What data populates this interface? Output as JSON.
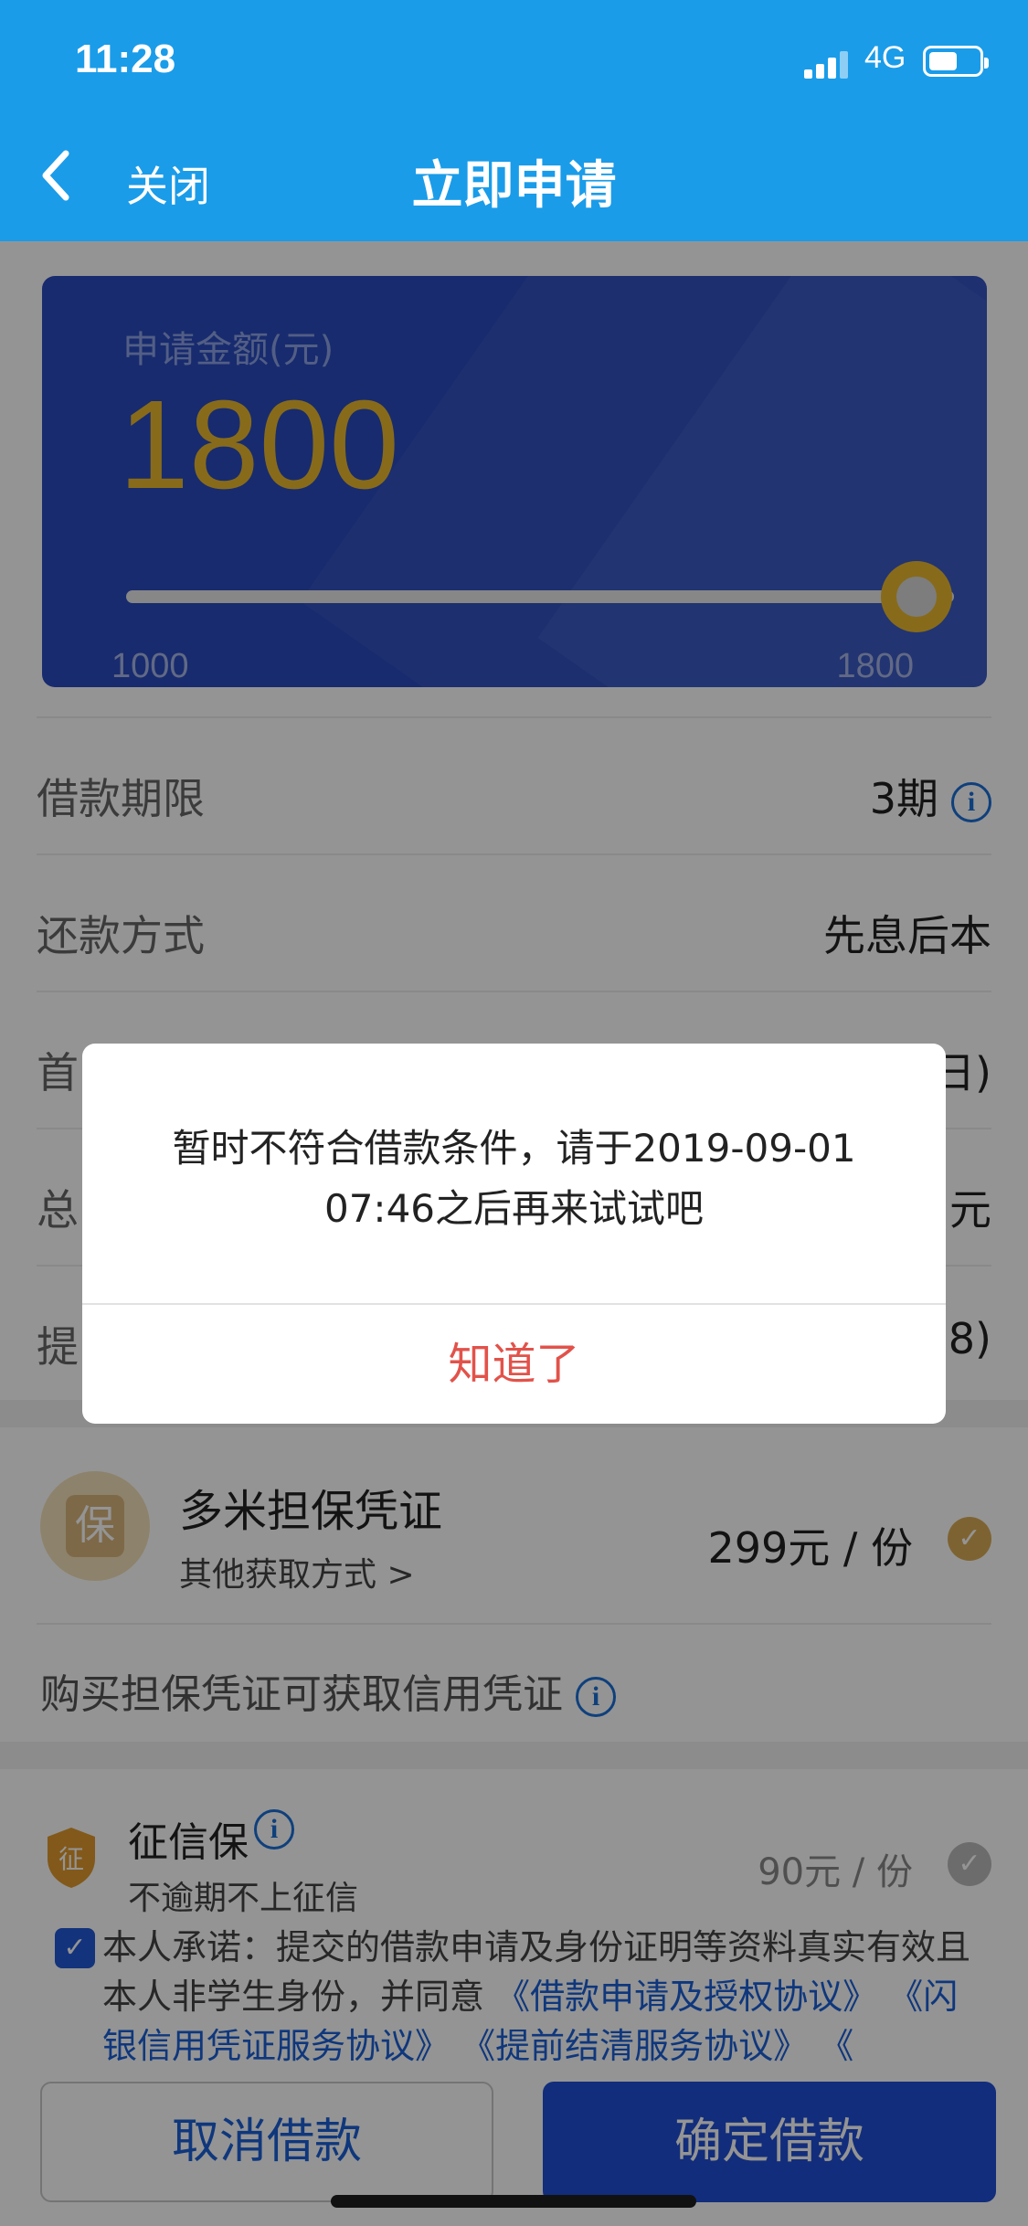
{
  "status_bar": {
    "time": "11:28",
    "network": "4G"
  },
  "nav": {
    "close_label": "关闭",
    "title": "立即申请"
  },
  "amount_card": {
    "label": "申请金额(元)",
    "amount": "1800",
    "min": "1000",
    "max": "1800",
    "slider_fraction": 1.0
  },
  "rows": [
    {
      "label": "借款期限",
      "value": "3期"
    },
    {
      "label": "还款方式",
      "value": "先息后本"
    },
    {
      "label": "首",
      "value": "日)"
    },
    {
      "label": "总",
      "value": "元"
    },
    {
      "label": "提",
      "value": "8)"
    }
  ],
  "product": {
    "icon_text": "保",
    "name": "多米担保凭证",
    "sub": "其他获取方式 >",
    "price": "299元 / 份"
  },
  "credit_note": "购买担保凭证可获取信用凭证",
  "insurance": {
    "icon_text": "征",
    "name": "征信保",
    "sub": "不逾期不上征信",
    "price": "90元 / 份"
  },
  "agreement": {
    "text_prefix": "本人承诺：提交的借款申请及身份证明等资料真实有效且本人非学生身份，并同意 ",
    "link1": "《借款申请及授权协议》",
    "link2": "《闪银信用凭证服务协议》",
    "link3": "《提前结清服务协议》",
    "link4": "《"
  },
  "buttons": {
    "cancel": "取消借款",
    "confirm": "确定借款"
  },
  "dialog": {
    "message_line1": "暂时不符合借款条件，请于2019-09-01",
    "message_line2": "07:46之后再来试试吧",
    "button": "知道了"
  },
  "colors": {
    "nav_bg": "#1a9ce9",
    "card_bg": "#2a4bbe",
    "amount": "#e8b930",
    "link": "#1a5fd6",
    "dialog_button": "#e2524a",
    "confirm_bg": "#1f4fd4"
  }
}
